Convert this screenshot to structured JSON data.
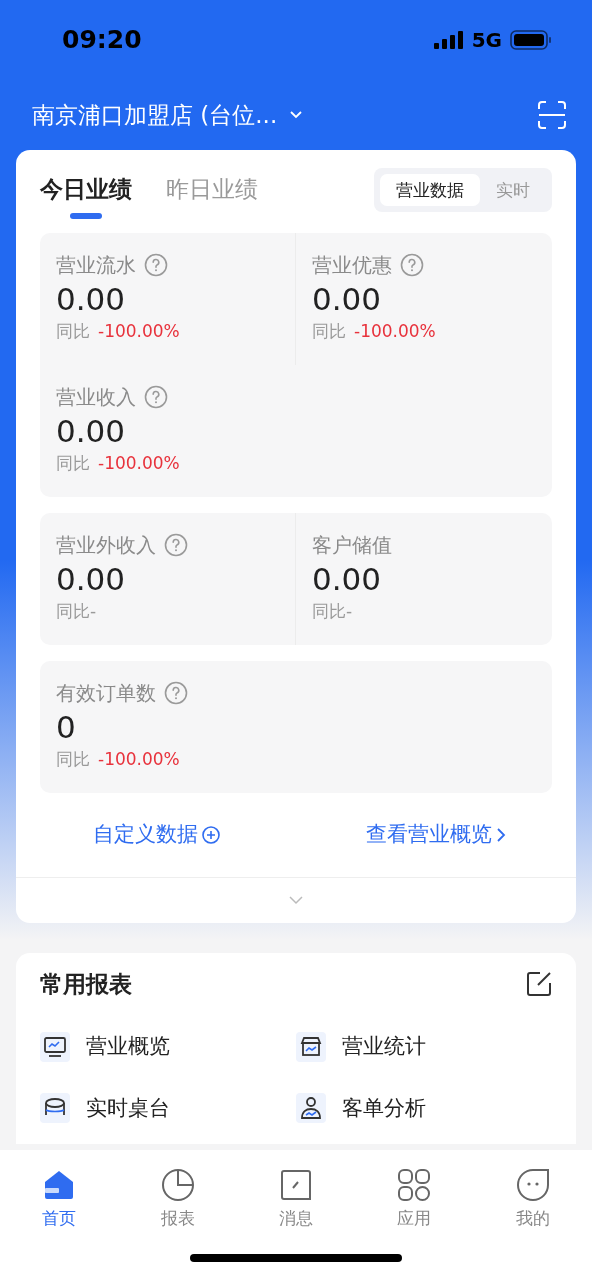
{
  "status_bar": {
    "time": "09:20",
    "network": "5G"
  },
  "header": {
    "store": "南京浦口加盟店 (台位..."
  },
  "performance": {
    "tabs": [
      {
        "label": "今日业绩",
        "selected": true
      },
      {
        "label": "昨日业绩",
        "selected": false
      }
    ],
    "segments": [
      {
        "label": "营业数据",
        "selected": true
      },
      {
        "label": "实时",
        "selected": false
      }
    ],
    "groups": [
      {
        "metrics": [
          {
            "label": "营业流水",
            "help": true,
            "value": "0.00",
            "compare_label": "同比",
            "change": "-100.00%",
            "kind": "decline"
          },
          {
            "label": "营业优惠",
            "help": true,
            "value": "0.00",
            "compare_label": "同比",
            "change": "-100.00%",
            "kind": "decline"
          },
          {
            "label": "营业收入",
            "help": true,
            "value": "0.00",
            "compare_label": "同比",
            "change": "-100.00%",
            "kind": "decline"
          }
        ]
      },
      {
        "metrics": [
          {
            "label": "营业外收入",
            "help": true,
            "value": "0.00",
            "compare_label": "同比",
            "change": "-",
            "kind": "none"
          },
          {
            "label": "客户储值",
            "help": false,
            "value": "0.00",
            "compare_label": "同比",
            "change": "-",
            "kind": "none"
          }
        ]
      },
      {
        "metrics": [
          {
            "label": "有效订单数",
            "help": true,
            "value": "0",
            "compare_label": "同比",
            "change": "-100.00%",
            "kind": "decline"
          }
        ]
      }
    ],
    "links": [
      {
        "label": "自定义数据",
        "kind": "add"
      },
      {
        "label": "查看营业概览",
        "kind": "more"
      }
    ]
  },
  "reports": {
    "title": "常用报表",
    "items": [
      {
        "label": "营业概览",
        "kind": "monitor"
      },
      {
        "label": "营业统计",
        "kind": "store"
      },
      {
        "label": "实时桌台",
        "kind": "table"
      },
      {
        "label": "客单分析",
        "kind": "person"
      }
    ]
  },
  "bottom_nav": [
    {
      "label": "首页",
      "kind": "home",
      "selected": true
    },
    {
      "label": "报表",
      "kind": "chart",
      "selected": false
    },
    {
      "label": "消息",
      "kind": "message",
      "selected": false
    },
    {
      "label": "应用",
      "kind": "apps",
      "selected": false
    },
    {
      "label": "我的",
      "kind": "profile",
      "selected": false
    }
  ]
}
